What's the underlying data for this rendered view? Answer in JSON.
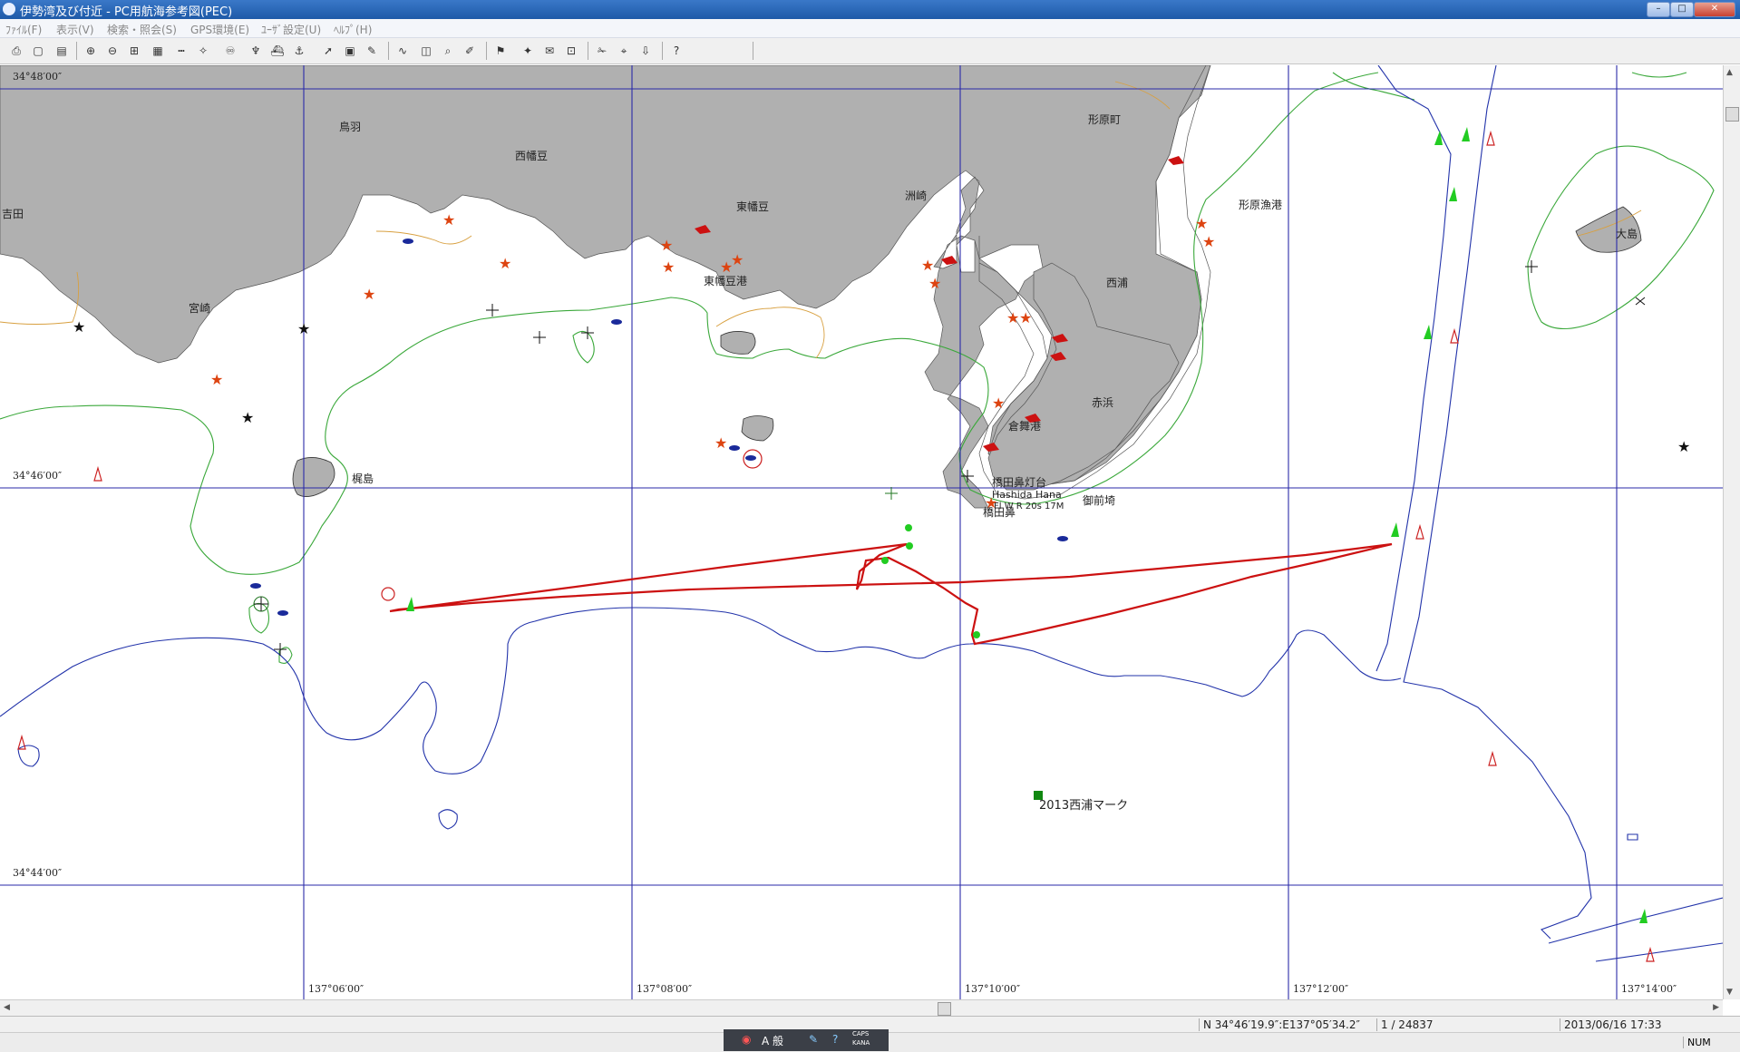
{
  "window": {
    "title": "伊勢湾及び付近 - PC用航海参考図(PEC)"
  },
  "menu": [
    "ﾌｧｲﾙ(F)",
    "表示(V)",
    "検索・照会(S)",
    "GPS環境(E)",
    "ﾕｰｻﾞ設定(U)",
    "ﾍﾙﾌﾟ(H)"
  ],
  "map": {
    "coords": {
      "lat_top": "34°48′00″",
      "lat_mid": "34°46′00″",
      "lat_bottom": "34°44′00″",
      "lon1": "137°06′00″",
      "lon2": "137°08′00″",
      "lon3": "137°10′00″",
      "lon4": "137°12′00″",
      "lon5": "137°14′00″"
    },
    "places": {
      "yoshida": "吉田",
      "toba": "鳥羽",
      "nishihazu": "西幡豆",
      "higashihazu": "東幡豆",
      "suzaki": "洲崎",
      "katahara": "形原町",
      "katahara_port": "形原漁港",
      "miyazaki": "宮崎",
      "kajishima": "梶島",
      "higashihazu_port": "東幡豆港",
      "nishiura": "西浦",
      "akahama": "赤浜",
      "kuramai": "倉舞港",
      "oshima": "大島",
      "hashitahana_light": "橋田鼻灯台",
      "hashitahana_en": "Hashida Hana",
      "light_char": "Fl W R 20s 17M",
      "gozenzaki": "御前埼",
      "hashitahana2": "橋田鼻",
      "mark2013": "2013西浦マーク"
    }
  },
  "status": {
    "position": "N 34°46′19.9″:E137°05′34.2″",
    "scale": "1 / 24837",
    "datetime": "2013/06/16 17:33",
    "num": "NUM"
  },
  "ime": {
    "label": "A 般",
    "caps": "CAPS",
    "kana": "KANA"
  },
  "colors": {
    "land": "#b0b0b0",
    "contour_green": "#3aa83a",
    "depth_blue": "#2233aa",
    "track_red": "#cc1111",
    "sand": "#d8a040",
    "grid": "#2a2aa8"
  },
  "icons": [
    "print-icon",
    "preview-icon",
    "open-icon",
    "zoom-in-icon",
    "zoom-out-icon",
    "binoculars-icon",
    "buoy-icon",
    "ship-icon",
    "route-icon",
    "help-icon"
  ]
}
